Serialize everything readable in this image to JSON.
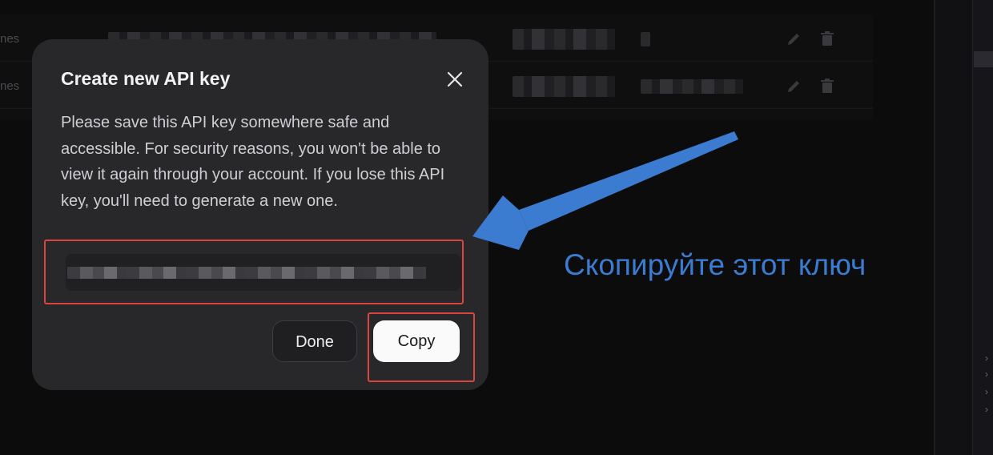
{
  "background": {
    "rows": [
      {
        "name": "nes"
      },
      {
        "name": "nes"
      }
    ]
  },
  "modal": {
    "title": "Create new API key",
    "description": "Please save this API key somewhere safe and accessible. For security reasons, you won't be able to view it again through your account. If you lose this API key, you'll need to generate a new one.",
    "key_value": "",
    "buttons": {
      "done": "Done",
      "copy": "Copy"
    }
  },
  "annotation": {
    "text": "Скопируйте этот ключ",
    "color": "#3b7bd0",
    "highlight_color": "#d9463f"
  },
  "icons": {
    "close": "close-icon",
    "edit": "pencil-icon",
    "delete": "trash-icon",
    "chevron": "chevron-right-icon"
  }
}
